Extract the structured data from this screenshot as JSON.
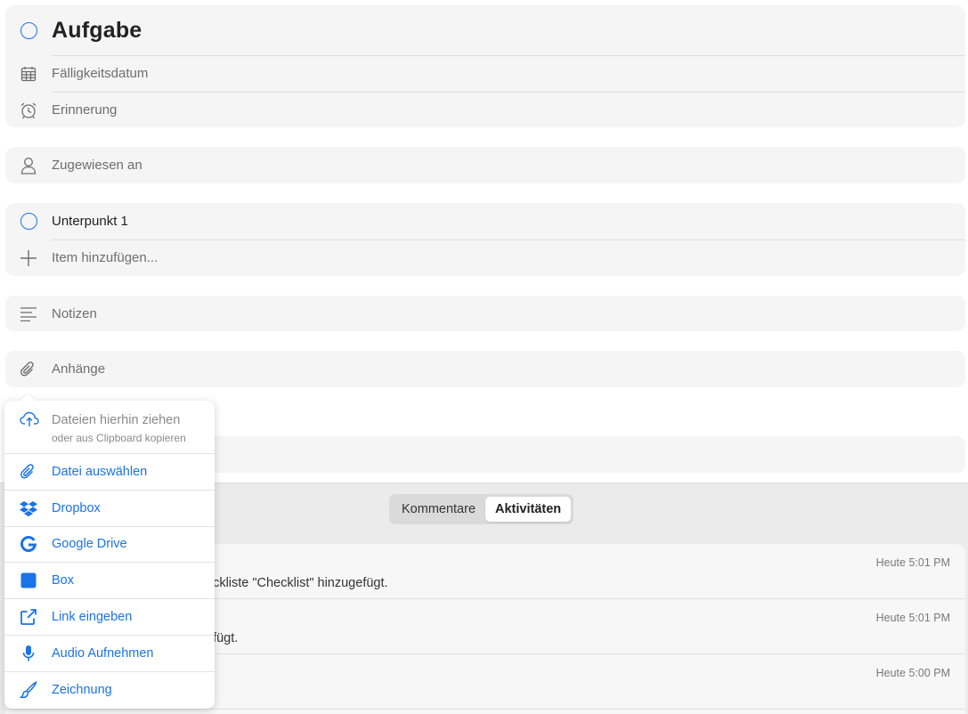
{
  "task": {
    "title": "Aufgabe",
    "due_label": "Fälligkeitsdatum",
    "reminder_label": "Erinnerung"
  },
  "assigned": {
    "label": "Zugewiesen an"
  },
  "checklist": {
    "items": [
      {
        "label": "Unterpunkt 1"
      }
    ],
    "add_placeholder": "Item hinzufügen..."
  },
  "notes": {
    "label": "Notizen"
  },
  "attachments": {
    "label": "Anhänge"
  },
  "attach_menu": {
    "drop_title": "Dateien hierhin ziehen",
    "drop_subtitle": "oder aus Clipboard kopieren",
    "items": [
      {
        "label": "Datei auswählen",
        "icon": "paperclip-icon"
      },
      {
        "label": "Dropbox",
        "icon": "dropbox-icon"
      },
      {
        "label": "Google Drive",
        "icon": "google-drive-icon"
      },
      {
        "label": "Box",
        "icon": "box-icon"
      },
      {
        "label": "Link eingeben",
        "icon": "external-link-icon"
      },
      {
        "label": "Audio Aufnehmen",
        "icon": "microphone-icon"
      },
      {
        "label": "Zeichnung",
        "icon": "brush-icon"
      }
    ]
  },
  "tabs": {
    "comments": "Kommentare",
    "activities": "Aktivitäten",
    "active": "Aktivitäten"
  },
  "activities": [
    {
      "time": "Heute 5:01 PM",
      "text": "eckliste \"Checklist\" hinzugefügt."
    },
    {
      "time": "Heute 5:01 PM",
      "text": "efügt."
    },
    {
      "time": "Heute 5:00 PM",
      "text": ""
    }
  ],
  "colors": {
    "accent": "#1a73e8",
    "card_bg": "#f5f5f5",
    "section_bg": "#ebebeb"
  }
}
